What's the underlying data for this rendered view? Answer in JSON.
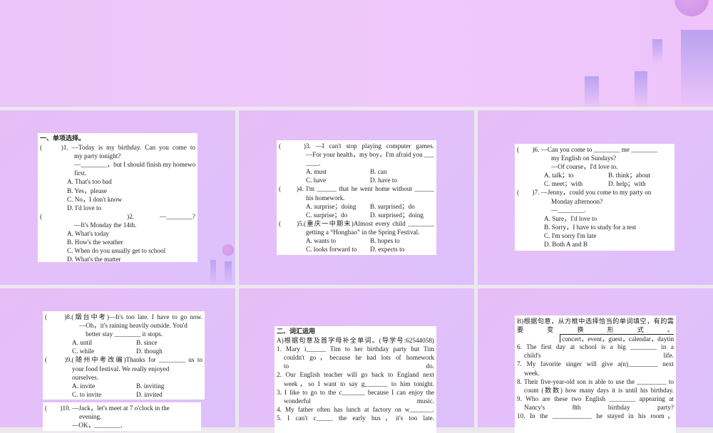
{
  "colors": {
    "bg": "#ece8ee",
    "slide": "#e4c0fa",
    "card": "#ffffff"
  },
  "cards": [
    {
      "id": "card-1",
      "lines": [
        {
          "t": "head",
          "text": "一、单项选择。"
        },
        {
          "t": "q",
          "text": "(　　)1. —Today is my birthday. Can you come to"
        },
        {
          "t": "ind",
          "text": "my party tonight?"
        },
        {
          "t": "ind",
          "text": "—________，but I should finish my homework"
        },
        {
          "t": "ind",
          "text": "first."
        },
        {
          "t": "opt",
          "text": "A. That's too bad"
        },
        {
          "t": "opt",
          "text": "B. Yes，please"
        },
        {
          "t": "opt",
          "text": "C. No，I don't know"
        },
        {
          "t": "opt",
          "text": "D. I'd love to"
        },
        {
          "t": "q",
          "text": "(　　)2. —________?"
        },
        {
          "t": "ind",
          "text": "—It's Monday the 14th."
        },
        {
          "t": "opt",
          "text": "A. What's today"
        },
        {
          "t": "opt",
          "text": "B. How's the weather"
        },
        {
          "t": "opt",
          "text": "C. When do you usually get to school"
        },
        {
          "t": "opt",
          "text": "D. What's the matter"
        }
      ]
    },
    {
      "id": "card-2",
      "lines": [
        {
          "t": "q",
          "text": "(　　)3. —I can't stop playing computer games."
        },
        {
          "t": "ind2",
          "text": "—For your health，my boy，I'm afraid you ____"
        },
        {
          "t": "ind2",
          "text": "____."
        },
        {
          "t": "two",
          "a": "A. must",
          "b": "B. can"
        },
        {
          "t": "two",
          "a": "C. have",
          "b": "D. have to"
        },
        {
          "t": "q",
          "text": "(　　)4. I'm ______ that he went home without ______"
        },
        {
          "t": "ind2",
          "text": "his homework."
        },
        {
          "t": "two",
          "a": "A. surprise；doing",
          "b": "B. surprised；do"
        },
        {
          "t": "two",
          "a": "C. surprise；do",
          "b": "D. surprised；doing"
        },
        {
          "t": "q",
          "text": "(　　)5.(重庆一中期末)Almost every child ________"
        },
        {
          "t": "ind2",
          "text": "getting a “Honghao” in the Spring Festival."
        },
        {
          "t": "two",
          "a": "A. wants to",
          "b": "B. hopes to"
        },
        {
          "t": "two",
          "a": "C. looks forward to",
          "b": "D. expects to"
        }
      ]
    },
    {
      "id": "card-3",
      "lines": [
        {
          "t": "q",
          "text": "(　　)6. —Can you come to ________ me ________"
        },
        {
          "t": "ind",
          "text": "my English on Sundays?"
        },
        {
          "t": "ind",
          "text": "—Of course，I'd love to."
        },
        {
          "t": "two",
          "a": "A. talk；to",
          "b": "B. think；about"
        },
        {
          "t": "two",
          "a": "C. meet；with",
          "b": "D. help；with"
        },
        {
          "t": "q",
          "text": "(　　)7. —Jenny，could you come to my party on"
        },
        {
          "t": "ind",
          "text": "Monday afternoon?"
        },
        {
          "t": "ind",
          "text": "—________."
        },
        {
          "t": "opt",
          "text": "A. Sure，I'd love to"
        },
        {
          "t": "opt",
          "text": "B. Sorry，I have to study for a test"
        },
        {
          "t": "opt",
          "text": "C. I'm sorry I'm late"
        },
        {
          "t": "opt",
          "text": "D. Both A and B"
        }
      ]
    },
    {
      "id": "card-4",
      "lines": [
        {
          "t": "q",
          "text": "(　　)8.(烟台中考)—It's too late. I have to go now."
        },
        {
          "t": "ind",
          "text": "—Oh，it's raining heavily outside. You'd"
        },
        {
          "t": "ind",
          "text": "　better stay ________ it stops."
        },
        {
          "t": "two",
          "a": "A. until",
          "b": "B. since"
        },
        {
          "t": "two",
          "a": "C. while",
          "b": "D. though"
        },
        {
          "t": "q",
          "text": "(　　)9.(随州中考改编)Thanks for ________ us to"
        },
        {
          "t": "ind2",
          "text": "your food festival. We really enjoyed"
        },
        {
          "t": "ind2",
          "text": "ourselves."
        },
        {
          "t": "two",
          "a": "A. invite",
          "b": "B. inviting"
        },
        {
          "t": "two",
          "a": "C. to invite",
          "b": "D. invited"
        }
      ]
    },
    {
      "id": "card-4b",
      "lines": [
        {
          "t": "q",
          "text": "(　　)10. —Jack，let's meet at 7 o'clock in the"
        },
        {
          "t": "ind",
          "text": "evening."
        },
        {
          "t": "ind2",
          "text": "—OK，________."
        }
      ]
    },
    {
      "id": "card-5",
      "lines": [
        {
          "t": "head",
          "text": "二、词汇运用"
        },
        {
          "t": "plain",
          "text": "A)根据句意及首字母补全单词。(导学号:62544058)"
        },
        {
          "t": "plain",
          "text": "1. Mary i______ Tim to her birthday party but Tim"
        },
        {
          "t": "num",
          "text": "couldn't go，because he had lots of homework"
        },
        {
          "t": "num",
          "text": "to do."
        },
        {
          "t": "plain",
          "text": "2. Our English teacher will go back to England next"
        },
        {
          "t": "num",
          "text": "week，so I want to say g_______ to him tonight."
        },
        {
          "t": "plain",
          "text": "3. I like to go to the c_______ because I can enjoy the"
        },
        {
          "t": "num",
          "text": "wonderful music."
        },
        {
          "t": "plain",
          "text": "4. My father often has lunch at factory on w_______."
        },
        {
          "t": "plain",
          "text": "5. I can't c_____ the early bus，it's too late."
        }
      ]
    },
    {
      "id": "card-6",
      "lines": [
        {
          "t": "plain",
          "text": "B)根据句意，从方框中选择恰当的单词填空，有的需"
        },
        {
          "t": "plain",
          "text": "要变换形式。"
        },
        {
          "t": "box",
          "text": "concert，event，guest，calendar，daytime"
        },
        {
          "t": "plain",
          "text": "6. The first day at school is a big ________ in a"
        },
        {
          "t": "num",
          "text": "child's life."
        },
        {
          "t": "plain",
          "text": "7. My favorite singer will give a(n)_________ next"
        },
        {
          "t": "num",
          "text": "week."
        },
        {
          "t": "plain",
          "text": "8. Their five-year-old son is able to use the _________ to"
        },
        {
          "t": "num",
          "text": "count (数数) how many days it is until his birthday."
        },
        {
          "t": "plain",
          "text": "9. Who are these two English ________ appearing at"
        },
        {
          "t": "num",
          "text": "Nancy's 8th birthday party?"
        },
        {
          "t": "plain",
          "text": "10. In the ____________ he stayed in his room，"
        }
      ]
    }
  ]
}
